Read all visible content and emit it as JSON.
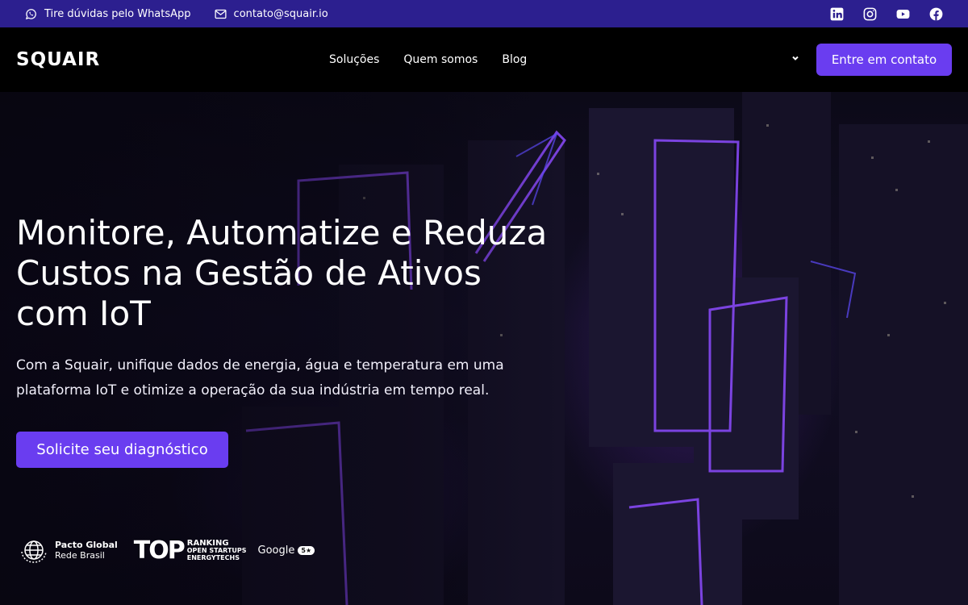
{
  "topbar": {
    "whatsapp_text": "Tire dúvidas pelo WhatsApp",
    "email_text": "contato@squair.io",
    "socials": [
      "linkedin-icon",
      "instagram-icon",
      "youtube-icon",
      "facebook-icon"
    ],
    "background": "#2c1f8f"
  },
  "nav": {
    "logo": "SQUAIR",
    "links": [
      "Soluções",
      "Quem somos",
      "Blog"
    ],
    "cta": "Entre em contato",
    "accent": "#6a3df0"
  },
  "hero": {
    "title": "Monitore, Automatize e Reduza Custos na Gestão de Ativos com IoT",
    "subtitle": "Com a Squair, unifique dados de energia, água e temperatura em uma plataforma IoT e otimize a operação da sua indústria em tempo real.",
    "cta": "Solicite seu diagnóstico"
  },
  "badges": {
    "pacto_title": "Pacto Global",
    "pacto_sub": "Rede Brasil",
    "top_text": "TOP",
    "ranking_1": "RANKING",
    "ranking_2": "OPEN STARTUPS",
    "ranking_3": "ENERGYTECHS",
    "google_text": "Google",
    "google_rating": "5★"
  }
}
